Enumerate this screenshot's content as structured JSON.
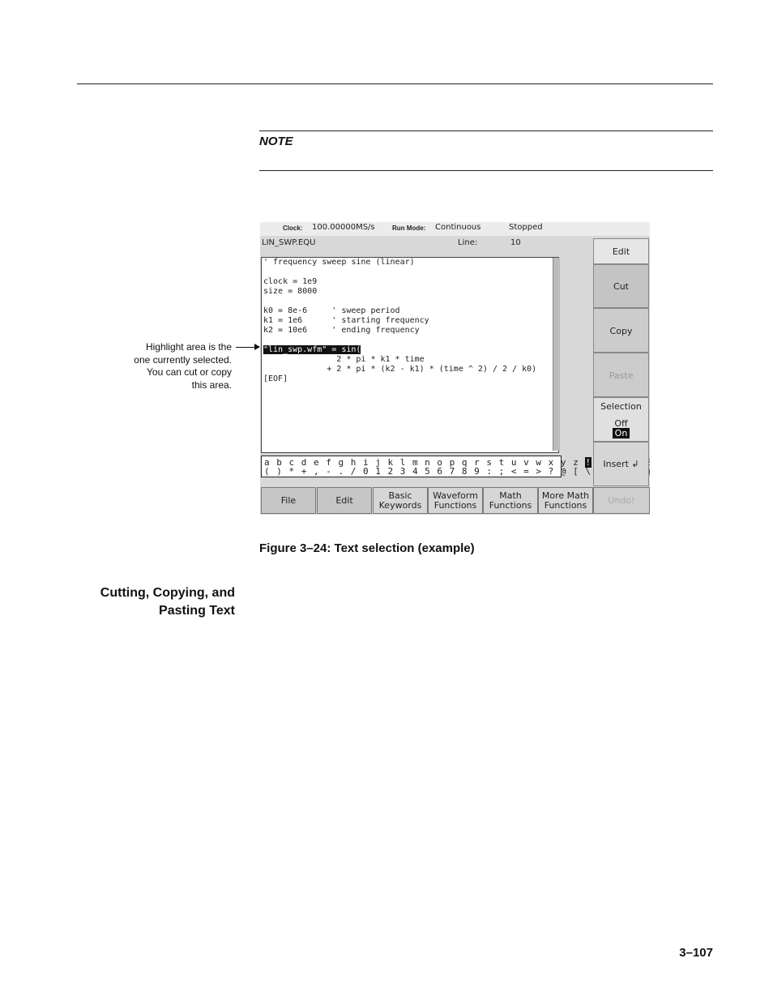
{
  "note": {
    "label": "NOTE"
  },
  "figure": {
    "status": {
      "clock_label": "Clock:",
      "clock_value": "100.00000MS/s",
      "run_mode_label": "Run Mode:",
      "run_mode_value": "Continuous",
      "state": "Stopped"
    },
    "file_name": "LIN_SWP.EQU",
    "line_label": "Line:",
    "line_value": "10",
    "editor_lines": [
      "' frequency sweep sine (linear)",
      "",
      "clock = 1e9",
      "size = 8000",
      "",
      "k0 = 8e-6     ' sweep period",
      "k1 = 1e6      ' starting frequency",
      "k2 = 10e6     ' ending frequency",
      "",
      "",
      "               2 * pi * k1 * time",
      "             + 2 * pi * (k2 - k1) * (time ^ 2) / 2 / k0)",
      "[EOF]"
    ],
    "highlighted_line": "\"lin_swp.wfm\" = sin(",
    "char_row1_a": "a b c d e f g h i j k l m n o p q r s t u v w x y z ",
    "char_row1_sel": "!",
    "char_row1_b": " \" # $ % & '",
    "char_row2": "( ) * + , - . / 0 1 2 3 4 5 6 7 8 9 : ; < = > ? @ [ \\ ] ^ _ ` { | } ~",
    "side_menu": {
      "edit": "Edit",
      "cut": "Cut",
      "copy": "Copy",
      "paste": "Paste",
      "selection": "Selection",
      "off": "Off",
      "on": "On",
      "insert": "Insert ↲"
    },
    "bottom_menu": {
      "file": "File",
      "edit": "Edit",
      "basic_1": "Basic",
      "basic_2": "Keywords",
      "waveform_1": "Waveform",
      "waveform_2": "Functions",
      "math_1": "Math",
      "math_2": "Functions",
      "more_1": "More Math",
      "more_2": "Functions",
      "undo": "Undo!"
    }
  },
  "callout": {
    "line1": "Highlight area is the",
    "line2": "one currently selected.",
    "line3": "You can cut or copy",
    "line4": "this area."
  },
  "caption": "Figure 3–24: Text selection (example)",
  "section_heading": {
    "line1": "Cutting, Copying, and",
    "line2": "Pasting Text"
  },
  "page_number": "3–107"
}
